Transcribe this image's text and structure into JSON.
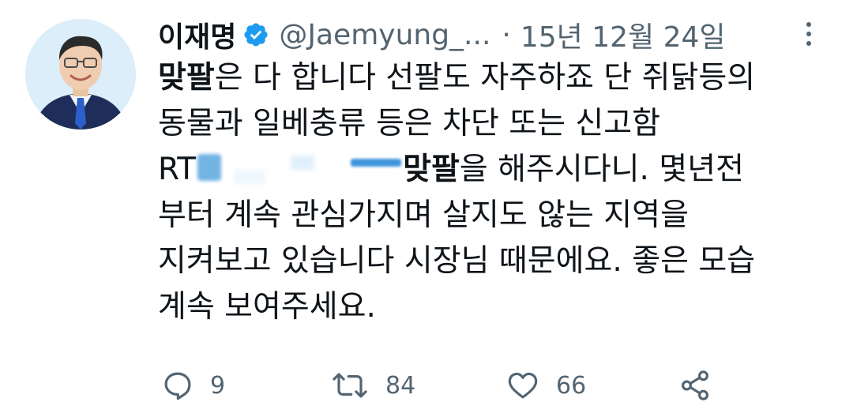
{
  "tweet": {
    "author_name": "이재명",
    "handle": "@Jaemyung_...",
    "separator": "·",
    "date": "15년 12월 24일",
    "body": {
      "line1_bold": "맞팔",
      "line1_rest": "은 다 합니다 선팔도 자주하죠 단 쥐닭등의",
      "line2": "동물과 일베충류 등은 차단 또는 신고함",
      "line3_prefix": "RT",
      "line3_bold": "맞팔",
      "line3_rest": "을 해주시다니. 몇년전",
      "line4": "부터 계속 관심가지며 살지도 않는 지역을",
      "line5": "지켜보고 있습니다 시장님 때문에요. 좋은 모습",
      "line6": "계속 보여주세요."
    },
    "actions": {
      "reply_count": "9",
      "retweet_count": "84",
      "like_count": "66"
    },
    "icons": {
      "verified": "verified-badge-icon",
      "more": "more-vertical-icon",
      "reply": "reply-icon",
      "retweet": "retweet-icon",
      "like": "heart-icon",
      "share": "share-icon"
    },
    "colors": {
      "verified_blue": "#1d9bf0",
      "secondary_text": "#536471",
      "primary_text": "#0f1419"
    }
  }
}
